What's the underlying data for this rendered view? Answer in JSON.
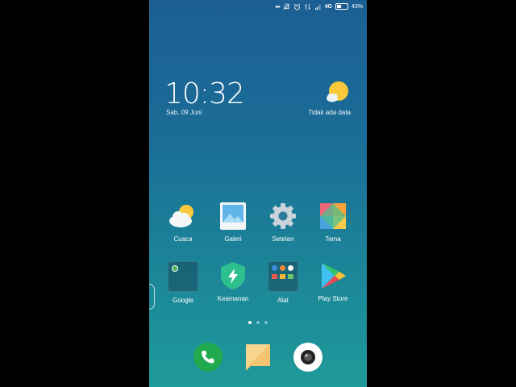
{
  "statusbar": {
    "network": "4G",
    "battery": "43%",
    "battery_level": 0.43
  },
  "lockwidget": {
    "time": "10:32",
    "date": "Sab, 09 Juni",
    "weather_status": "Tidak ada data"
  },
  "apps": [
    {
      "label": "Cuaca",
      "icon": "weather-icon"
    },
    {
      "label": "Galeri",
      "icon": "gallery-icon"
    },
    {
      "label": "Setelan",
      "icon": "settings-gear-icon"
    },
    {
      "label": "Tema",
      "icon": "themes-icon"
    },
    {
      "label": "Google",
      "icon": "google-folder-icon"
    },
    {
      "label": "Keamanan",
      "icon": "security-shield-icon"
    },
    {
      "label": "Alat",
      "icon": "tools-folder-icon"
    },
    {
      "label": "Play Store",
      "icon": "play-store-icon"
    }
  ],
  "pages": {
    "count": 3,
    "active": 1
  },
  "dock": [
    {
      "icon": "phone-icon"
    },
    {
      "icon": "messages-icon"
    },
    {
      "icon": "camera-icon"
    }
  ],
  "colors": {
    "phone_green": "#1faa4d",
    "message_orange": "#f5c46e",
    "accent_teal": "#1e9a9a"
  }
}
